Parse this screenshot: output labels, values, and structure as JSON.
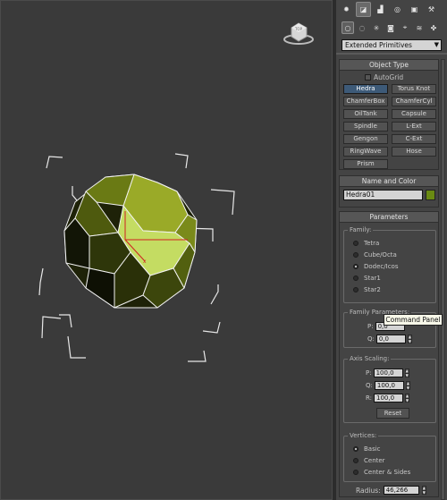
{
  "command_panel": {
    "tabs": [
      {
        "icon": "create-icon",
        "glyph": "✹"
      },
      {
        "icon": "modify-icon",
        "glyph": "◪"
      },
      {
        "icon": "hierarchy-icon",
        "glyph": "▟"
      },
      {
        "icon": "motion-icon",
        "glyph": "◎"
      },
      {
        "icon": "display-icon",
        "glyph": "▣"
      },
      {
        "icon": "utilities-icon",
        "glyph": "⚒"
      }
    ],
    "categories": [
      {
        "icon": "geometry-icon",
        "glyph": "○"
      },
      {
        "icon": "shapes-icon",
        "glyph": "◌"
      },
      {
        "icon": "lights-icon",
        "glyph": "✳"
      },
      {
        "icon": "cameras-icon",
        "glyph": "◙"
      },
      {
        "icon": "helpers-icon",
        "glyph": "⌖"
      },
      {
        "icon": "spacewarps-icon",
        "glyph": "≋"
      },
      {
        "icon": "systems-icon",
        "glyph": "✤"
      }
    ],
    "dropdown_value": "Extended Primitives",
    "object_type": {
      "title": "Object Type",
      "autogrid_label": "AutoGrid",
      "buttons": [
        "Hedra",
        "Torus Knot",
        "ChamferBox",
        "ChamferCyl",
        "OilTank",
        "Capsule",
        "Spindle",
        "L-Ext",
        "Gengon",
        "C-Ext",
        "RingWave",
        "Hose",
        "Prism"
      ],
      "active": "Hedra"
    },
    "name_and_color": {
      "title": "Name and Color",
      "name_value": "Hedra01",
      "color": "#6a8a12"
    },
    "parameters": {
      "title": "Parameters",
      "family_label": "Family:",
      "family_options": [
        "Tetra",
        "Cube/Octa",
        "Dodec/Icos",
        "Star1",
        "Star2"
      ],
      "family_selected": "Dodec/Icos",
      "family_params_label": "Family Parameters:",
      "p_label": "P:",
      "p_value": "0,0",
      "q_label": "Q:",
      "q_value": "0,0",
      "axis_scaling_label": "Axis Scaling:",
      "axis_p_label": "P:",
      "axis_p_value": "100,0",
      "axis_q_label": "Q:",
      "axis_q_value": "100,0",
      "axis_r_label": "R:",
      "axis_r_value": "100,0",
      "reset_label": "Reset",
      "vertices_label": "Vertices:",
      "vertices_options": [
        "Basic",
        "Center",
        "Center & Sides"
      ],
      "vertices_selected": "Basic",
      "radius_label": "Radius:",
      "radius_value": "46,266"
    },
    "tooltip": "Command Panel"
  },
  "viewport": {
    "viewcube_label": "TOP",
    "object_color": "#6a7a10",
    "highlight_color": "#c8e070"
  }
}
